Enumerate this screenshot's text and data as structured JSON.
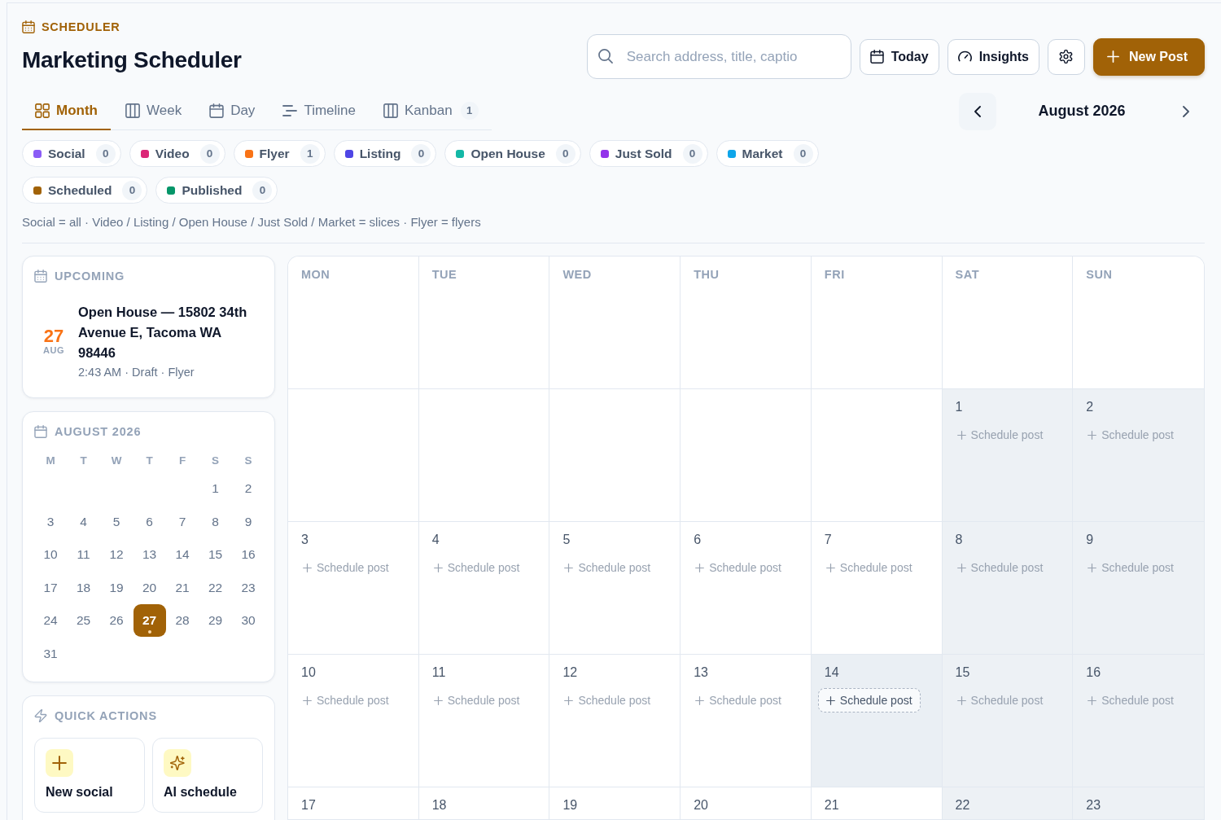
{
  "header": {
    "eyebrow": "SCHEDULER",
    "title": "Marketing Scheduler"
  },
  "toolbar": {
    "search": {
      "placeholder": "Search address, title, captio"
    },
    "buttons": [
      {
        "kind": "today",
        "label": "Today"
      },
      {
        "kind": "insights",
        "label": "Insights"
      },
      {
        "kind": "settings"
      },
      {
        "kind": "create",
        "label": "New Post"
      }
    ]
  },
  "views": [
    {
      "kind": "month",
      "label": "Month",
      "selected": true
    },
    {
      "kind": "week",
      "label": "Week",
      "selected": false
    },
    {
      "kind": "day",
      "label": "Day",
      "selected": false
    },
    {
      "kind": "timeline",
      "label": "Timeline",
      "selected": false
    },
    {
      "kind": "kanban",
      "label": "Kanban",
      "selected": false,
      "count": "1"
    }
  ],
  "period_nav": {
    "title": "August 2026",
    "buttons": [
      {
        "kind": "prev",
        "hovered": true
      },
      {
        "kind": "next",
        "hovered": false
      }
    ]
  },
  "filters": {
    "types": [
      {
        "label": "Social",
        "count": "0",
        "color": "#8b5cf6"
      },
      {
        "label": "Video",
        "count": "0",
        "color": "#db2777"
      },
      {
        "label": "Flyer",
        "count": "1",
        "color": "#f97316"
      },
      {
        "label": "Listing",
        "count": "0",
        "color": "#4f46e5"
      },
      {
        "label": "Open House",
        "count": "0",
        "color": "#14b8a6"
      },
      {
        "label": "Just Sold",
        "count": "0",
        "color": "#9333ea"
      },
      {
        "label": "Market",
        "count": "0",
        "color": "#0ea5e9"
      }
    ],
    "statuses": [
      {
        "label": "Scheduled",
        "count": "0",
        "color": "#a16207"
      },
      {
        "label": "Published",
        "count": "0",
        "color": "#059669"
      }
    ]
  },
  "legend_note": "Social = all · Video / Listing / Open House / Just Sold / Market = slices · Flyer = flyers",
  "upcoming": {
    "title": "UPCOMING",
    "items": [
      {
        "day": "27",
        "month": "AUG",
        "title": "Open House — 15802 34th Avenue E, Tacoma WA 98446",
        "meta": "2:43 AM · Draft · Flyer"
      }
    ]
  },
  "mini_calendar": {
    "title": "AUGUST 2026",
    "weekdays": [
      "M",
      "T",
      "W",
      "T",
      "F",
      "S",
      "S"
    ],
    "days": [
      {
        "kind": "blank"
      },
      {
        "kind": "blank"
      },
      {
        "kind": "blank"
      },
      {
        "kind": "blank"
      },
      {
        "kind": "blank"
      },
      {
        "kind": "date",
        "day": "1",
        "selected": false,
        "marked": false
      },
      {
        "kind": "date",
        "day": "2",
        "selected": false,
        "marked": false
      },
      {
        "kind": "date",
        "day": "3",
        "selected": false,
        "marked": false
      },
      {
        "kind": "date",
        "day": "4",
        "selected": false,
        "marked": false
      },
      {
        "kind": "date",
        "day": "5",
        "selected": false,
        "marked": false
      },
      {
        "kind": "date",
        "day": "6",
        "selected": false,
        "marked": false
      },
      {
        "kind": "date",
        "day": "7",
        "selected": false,
        "marked": false
      },
      {
        "kind": "date",
        "day": "8",
        "selected": false,
        "marked": false
      },
      {
        "kind": "date",
        "day": "9",
        "selected": false,
        "marked": false
      },
      {
        "kind": "date",
        "day": "10",
        "selected": false,
        "marked": false
      },
      {
        "kind": "date",
        "day": "11",
        "selected": false,
        "marked": false
      },
      {
        "kind": "date",
        "day": "12",
        "selected": false,
        "marked": false
      },
      {
        "kind": "date",
        "day": "13",
        "selected": false,
        "marked": false
      },
      {
        "kind": "date",
        "day": "14",
        "selected": false,
        "marked": false
      },
      {
        "kind": "date",
        "day": "15",
        "selected": false,
        "marked": false
      },
      {
        "kind": "date",
        "day": "16",
        "selected": false,
        "marked": false
      },
      {
        "kind": "date",
        "day": "17",
        "selected": false,
        "marked": false
      },
      {
        "kind": "date",
        "day": "18",
        "selected": false,
        "marked": false
      },
      {
        "kind": "date",
        "day": "19",
        "selected": false,
        "marked": false
      },
      {
        "kind": "date",
        "day": "20",
        "selected": false,
        "marked": false
      },
      {
        "kind": "date",
        "day": "21",
        "selected": false,
        "marked": false
      },
      {
        "kind": "date",
        "day": "22",
        "selected": false,
        "marked": false
      },
      {
        "kind": "date",
        "day": "23",
        "selected": false,
        "marked": false
      },
      {
        "kind": "date",
        "day": "24",
        "selected": false,
        "marked": false
      },
      {
        "kind": "date",
        "day": "25",
        "selected": false,
        "marked": false
      },
      {
        "kind": "date",
        "day": "26",
        "selected": false,
        "marked": false
      },
      {
        "kind": "date",
        "day": "27",
        "selected": true,
        "marked": true
      },
      {
        "kind": "date",
        "day": "28",
        "selected": false,
        "marked": false
      },
      {
        "kind": "date",
        "day": "29",
        "selected": false,
        "marked": false
      },
      {
        "kind": "date",
        "day": "30",
        "selected": false,
        "marked": false
      },
      {
        "kind": "date",
        "day": "31",
        "selected": false,
        "marked": false
      }
    ]
  },
  "quick_actions": {
    "title": "QUICK ACTIONS",
    "items": [
      {
        "kind": "plus",
        "label": "New social"
      },
      {
        "kind": "sparkle",
        "label": "AI schedule"
      }
    ]
  },
  "calendar": {
    "weekdays": [
      "MON",
      "TUE",
      "WED",
      "THU",
      "FRI",
      "SAT",
      "SUN"
    ],
    "weeks": [
      [
        {
          "kind": "blank"
        },
        {
          "kind": "blank"
        },
        {
          "kind": "blank"
        },
        {
          "kind": "blank"
        },
        {
          "kind": "blank"
        },
        {
          "kind": "date",
          "day": "1",
          "shaded": true,
          "highlighted": false,
          "action": "Schedule post"
        },
        {
          "kind": "date",
          "day": "2",
          "shaded": true,
          "highlighted": false,
          "action": "Schedule post"
        }
      ],
      [
        {
          "kind": "date",
          "day": "3",
          "shaded": false,
          "highlighted": false,
          "action": "Schedule post"
        },
        {
          "kind": "date",
          "day": "4",
          "shaded": false,
          "highlighted": false,
          "action": "Schedule post"
        },
        {
          "kind": "date",
          "day": "5",
          "shaded": false,
          "highlighted": false,
          "action": "Schedule post"
        },
        {
          "kind": "date",
          "day": "6",
          "shaded": false,
          "highlighted": false,
          "action": "Schedule post"
        },
        {
          "kind": "date",
          "day": "7",
          "shaded": false,
          "highlighted": false,
          "action": "Schedule post"
        },
        {
          "kind": "date",
          "day": "8",
          "shaded": true,
          "highlighted": false,
          "action": "Schedule post"
        },
        {
          "kind": "date",
          "day": "9",
          "shaded": true,
          "highlighted": false,
          "action": "Schedule post"
        }
      ],
      [
        {
          "kind": "date",
          "day": "10",
          "shaded": false,
          "highlighted": false,
          "action": "Schedule post"
        },
        {
          "kind": "date",
          "day": "11",
          "shaded": false,
          "highlighted": false,
          "action": "Schedule post"
        },
        {
          "kind": "date",
          "day": "12",
          "shaded": false,
          "highlighted": false,
          "action": "Schedule post"
        },
        {
          "kind": "date",
          "day": "13",
          "shaded": false,
          "highlighted": false,
          "action": "Schedule post"
        },
        {
          "kind": "date",
          "day": "14",
          "shaded": false,
          "highlighted": true,
          "action": "Schedule post"
        },
        {
          "kind": "date",
          "day": "15",
          "shaded": true,
          "highlighted": false,
          "action": "Schedule post"
        },
        {
          "kind": "date",
          "day": "16",
          "shaded": true,
          "highlighted": false,
          "action": "Schedule post"
        }
      ],
      [
        {
          "kind": "date",
          "day": "17",
          "shaded": false,
          "highlighted": false
        },
        {
          "kind": "date",
          "day": "18",
          "shaded": false,
          "highlighted": false
        },
        {
          "kind": "date",
          "day": "19",
          "shaded": false,
          "highlighted": false
        },
        {
          "kind": "date",
          "day": "20",
          "shaded": false,
          "highlighted": false
        },
        {
          "kind": "date",
          "day": "21",
          "shaded": false,
          "highlighted": false
        },
        {
          "kind": "date",
          "day": "22",
          "shaded": true,
          "highlighted": false
        },
        {
          "kind": "date",
          "day": "23",
          "shaded": true,
          "highlighted": false
        }
      ]
    ]
  }
}
